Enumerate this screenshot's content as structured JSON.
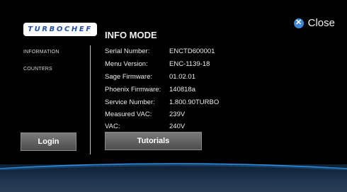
{
  "header": {
    "logo_text": "TURBOCHEF",
    "close_label": "Close",
    "close_icon": "close-icon",
    "accent_color": "#3a86d8"
  },
  "sidebar": {
    "items": [
      {
        "label": "INFORMATION"
      },
      {
        "label": "COUNTERS"
      }
    ],
    "login_label": "Login"
  },
  "main": {
    "title": "INFO MODE",
    "rows": [
      {
        "label": "Serial Number:",
        "value": "ENCTD600001"
      },
      {
        "label": "Menu Version:",
        "value": "ENC-1139-18"
      },
      {
        "label": "Sage Firmware:",
        "value": "01.02.01"
      },
      {
        "label": "Phoenix Firmware:",
        "value": "140818a"
      },
      {
        "label": "Service Number:",
        "value": "1.800.90TURBO"
      },
      {
        "label": "Measured VAC:",
        "value": "239V"
      },
      {
        "label": "VAC:",
        "value": "240V"
      }
    ],
    "tutorials_label": "Tutorials"
  }
}
